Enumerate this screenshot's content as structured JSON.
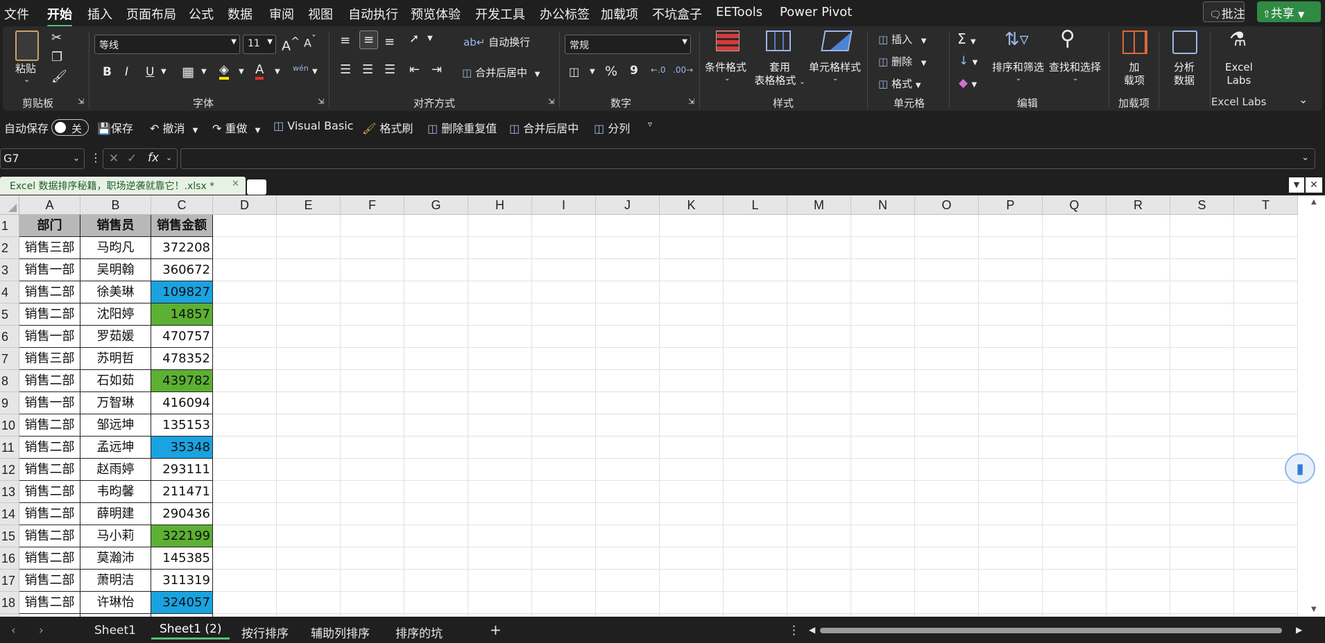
{
  "menu": {
    "items": [
      "文件",
      "开始",
      "插入",
      "页面布局",
      "公式",
      "数据",
      "审阅",
      "视图",
      "自动执行",
      "预览体验",
      "开发工具",
      "办公标签",
      "加载项",
      "不坑盒子",
      "EETools",
      "Power Pivot"
    ],
    "active": "开始",
    "comment_btn": "批注",
    "share_btn": "共享"
  },
  "ribbon": {
    "clipboard": {
      "paste": "粘贴",
      "label": "剪贴板"
    },
    "font": {
      "name": "等线",
      "size": "11",
      "label": "字体",
      "grow": "A",
      "shrink": "A",
      "bold": "B",
      "italic": "I",
      "underline": "U",
      "phonetic": "wén"
    },
    "alignment": {
      "wrap": "自动换行",
      "merge": "合并后居中",
      "label": "对齐方式"
    },
    "number": {
      "format": "常规",
      "label": "数字",
      "percent": "%",
      "comma": "9"
    },
    "styles": {
      "conditional": "条件格式",
      "table1": "套用",
      "table2": "表格格式",
      "cell_styles": "单元格样式",
      "label": "样式"
    },
    "cells": {
      "insert": "插入",
      "delete": "删除",
      "format": "格式",
      "label": "单元格"
    },
    "editing": {
      "sort1": "排序和筛选",
      "find": "查找和选择",
      "label": "编辑",
      "sum": "Σ"
    },
    "addins": {
      "l1": "加",
      "l2": "载项",
      "label": "加载项"
    },
    "analyze": {
      "l1": "分析",
      "l2": "数据"
    },
    "excel_labs": {
      "l1": "Excel",
      "l2": "Labs",
      "label": "Excel Labs"
    }
  },
  "qat": {
    "autosave": "自动保存",
    "toggle": "关",
    "save": "保存",
    "undo": "撤消",
    "redo": "重做",
    "vba": "Visual Basic",
    "format_painter": "格式刷",
    "remove_dup": "删除重复值",
    "merge_center": "合并后居中",
    "split": "分列"
  },
  "formula_bar": {
    "name_box": "G7",
    "fx": "fx",
    "formula": ""
  },
  "doc_tab": {
    "title": "Excel 数据排序秘籍，职场逆袭就靠它！.xlsx *"
  },
  "columns": [
    "A",
    "B",
    "C",
    "D",
    "E",
    "F",
    "G",
    "H",
    "I",
    "J",
    "K",
    "L",
    "M",
    "N",
    "O",
    "P",
    "Q",
    "R",
    "S",
    "T"
  ],
  "table": {
    "headers": [
      "部门",
      "销售员",
      "销售金额"
    ],
    "rows": [
      [
        "销售三部",
        "马昀凡",
        "372208",
        ""
      ],
      [
        "销售一部",
        "吴明翰",
        "360672",
        ""
      ],
      [
        "销售二部",
        "徐美琳",
        "109827",
        "blue"
      ],
      [
        "销售二部",
        "沈阳婷",
        "14857",
        "green"
      ],
      [
        "销售一部",
        "罗茹媛",
        "470757",
        ""
      ],
      [
        "销售三部",
        "苏明哲",
        "478352",
        ""
      ],
      [
        "销售二部",
        "石如茹",
        "439782",
        "green"
      ],
      [
        "销售一部",
        "万智琳",
        "416094",
        ""
      ],
      [
        "销售二部",
        "邹远坤",
        "135153",
        ""
      ],
      [
        "销售二部",
        "孟远坤",
        "35348",
        "blue"
      ],
      [
        "销售二部",
        "赵雨婷",
        "293111",
        ""
      ],
      [
        "销售二部",
        "韦昀馨",
        "211471",
        ""
      ],
      [
        "销售二部",
        "薛明建",
        "290436",
        ""
      ],
      [
        "销售二部",
        "马小莉",
        "322199",
        "green"
      ],
      [
        "销售二部",
        "莫瀚沛",
        "145385",
        ""
      ],
      [
        "销售二部",
        "萧明洁",
        "311319",
        ""
      ],
      [
        "销售二部",
        "许琳怡",
        "324057",
        "blue"
      ]
    ]
  },
  "colors": {
    "blue": "#1aa3e0",
    "green": "#5cb032",
    "header_fill": "#b8b8b8",
    "accent": "#4fc27a"
  },
  "sheets": {
    "tabs": [
      "Sheet1",
      "Sheet1 (2)",
      "按行排序",
      "辅助列排序",
      "排序的坑"
    ],
    "active": "Sheet1 (2)",
    "add": "+"
  }
}
